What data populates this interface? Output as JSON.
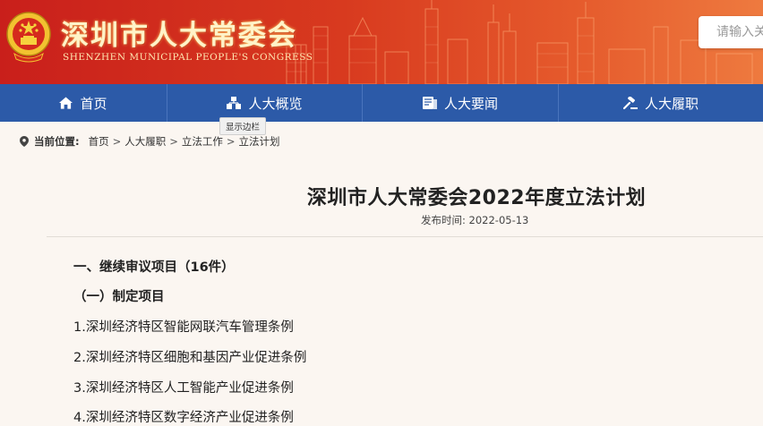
{
  "header": {
    "site_title": "深圳市人大常委会",
    "site_subtitle": "SHENZHEN MUNICIPAL PEOPLE'S CONGRESS",
    "search_placeholder": "请输入关",
    "emblem_icon": "national-emblem-icon",
    "colors": {
      "banner": "#d0291d",
      "title": "#fff3c8"
    }
  },
  "nav": {
    "items": [
      {
        "label": "首页",
        "icon": "home-icon"
      },
      {
        "label": "人大概览",
        "icon": "org-chart-icon"
      },
      {
        "label": "人大要闻",
        "icon": "news-icon"
      },
      {
        "label": "人大履职",
        "icon": "gavel-icon"
      }
    ],
    "tooltip": "显示边栏",
    "color": "#2c5aa8"
  },
  "breadcrumb": {
    "label": "当前位置:",
    "items": [
      "首页",
      "人大履职",
      "立法工作",
      "立法计划"
    ],
    "separator": ">",
    "icon": "location-pin-icon"
  },
  "article": {
    "title": "深圳市人大常委会2022年度立法计划",
    "publish_label": "发布时间:",
    "publish_date": "2022-05-13",
    "section_heading": "一、继续审议项目（16件）",
    "subsection_heading": "（一）制定项目",
    "items": [
      "1.深圳经济特区智能网联汽车管理条例",
      "2.深圳经济特区细胞和基因产业促进条例",
      "3.深圳经济特区人工智能产业促进条例",
      "4.深圳经济特区数字经济产业促进条例"
    ]
  }
}
